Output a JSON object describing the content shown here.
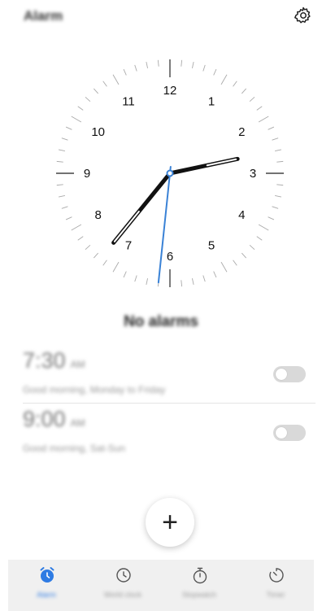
{
  "header": {
    "title": "Alarm"
  },
  "clock": {
    "numbers": [
      "12",
      "1",
      "2",
      "3",
      "4",
      "5",
      "6",
      "7",
      "8",
      "9",
      "10",
      "11"
    ],
    "time": {
      "hour": 2,
      "minute": 36,
      "second": 31
    },
    "accent_color": "#3a82d6"
  },
  "status": {
    "no_alarms": "No alarms"
  },
  "alarms": [
    {
      "time": "7:30",
      "ampm": "AM",
      "description": "Good morning, Monday to Friday",
      "enabled": false
    },
    {
      "time": "9:00",
      "ampm": "AM",
      "description": "Good morning, Sat-Sun",
      "enabled": false
    }
  ],
  "fab": {
    "label": "+"
  },
  "tabs": [
    {
      "label": "Alarm",
      "icon": "alarm-clock-icon",
      "active": true
    },
    {
      "label": "World clock",
      "icon": "clock-icon",
      "active": false
    },
    {
      "label": "Stopwatch",
      "icon": "stopwatch-icon",
      "active": false
    },
    {
      "label": "Timer",
      "icon": "timer-icon",
      "active": false
    }
  ],
  "colors": {
    "accent": "#2e7be3",
    "tabbar_bg": "#f0f0f0"
  }
}
